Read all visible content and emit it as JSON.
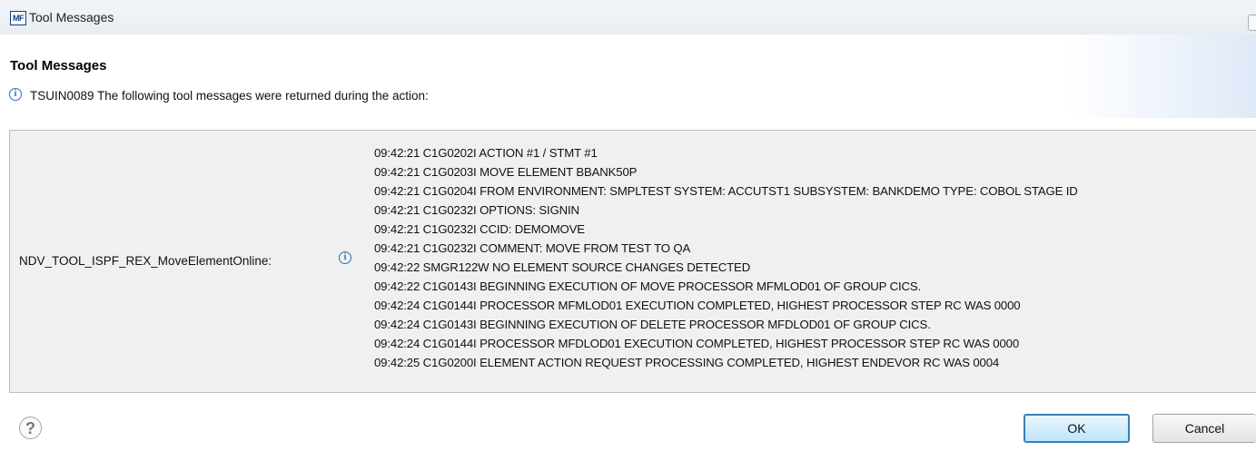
{
  "window": {
    "title": "Tool Messages",
    "app_icon_label": "MF"
  },
  "dialog": {
    "title": "Tool Messages",
    "message": "TSUIN0089 The following tool messages were returned during the action:"
  },
  "table": {
    "tool_name": "NDV_TOOL_ISPF_REX_MoveElementOnline:",
    "messages": [
      "09:42:21 C1G0202I ACTION #1 / STMT #1",
      "09:42:21 C1G0203I MOVE ELEMENT BBANK50P",
      "09:42:21 C1G0204I FROM ENVIRONMENT: SMPLTEST SYSTEM: ACCUTST1 SUBSYSTEM: BANKDEMO TYPE: COBOL STAGE ID",
      "09:42:21 C1G0232I OPTIONS: SIGNIN",
      "09:42:21 C1G0232I CCID: DEMOMOVE",
      "09:42:21 C1G0232I COMMENT: MOVE FROM TEST TO QA",
      "09:42:22 SMGR122W NO ELEMENT SOURCE CHANGES DETECTED",
      "09:42:22 C1G0143I BEGINNING EXECUTION OF MOVE PROCESSOR MFMLOD01 OF GROUP CICS.",
      "09:42:24 C1G0144I PROCESSOR MFMLOD01 EXECUTION COMPLETED, HIGHEST PROCESSOR STEP RC WAS 0000",
      "09:42:24 C1G0143I BEGINNING EXECUTION OF DELETE PROCESSOR MFDLOD01 OF GROUP CICS.",
      "09:42:24 C1G0144I PROCESSOR MFDLOD01 EXECUTION COMPLETED, HIGHEST PROCESSOR STEP RC WAS 0000",
      "09:42:25 C1G0200I ELEMENT ACTION REQUEST PROCESSING COMPLETED, HIGHEST ENDEVOR RC WAS 0004"
    ]
  },
  "buttons": {
    "help_glyph": "?",
    "ok_label": "OK",
    "cancel_label": "Cancel"
  },
  "icons": {
    "info_glyph": "i"
  },
  "colors": {
    "info_blue": "#2b6cb7",
    "ok_border": "#3c7fb1",
    "table_bg": "#f0f0f0"
  }
}
